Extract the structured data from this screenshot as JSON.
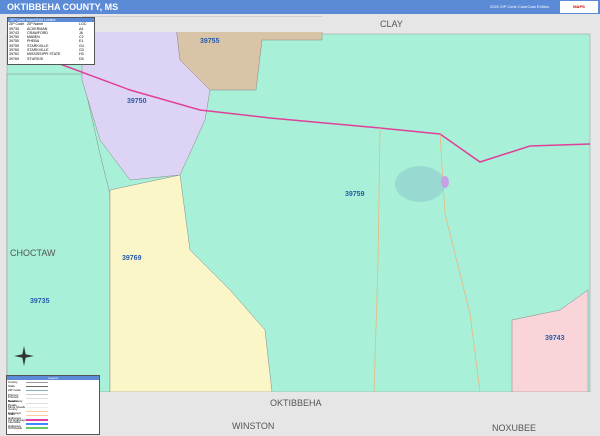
{
  "header": {
    "title": "OKTIBBEHA COUNTY, MS",
    "edition": "2020 ZIP Code ColorCast Edition",
    "logo": "MAPS"
  },
  "zip_table": {
    "title": "ZIP Code Index/Grid Locator",
    "columns": [
      "ZIP Code",
      "ZIP Name",
      "LOC"
    ],
    "rows": [
      [
        "39735",
        "ACKERMAN",
        "A4"
      ],
      [
        "39743",
        "CRAWFORD",
        "J6"
      ],
      [
        "39750",
        "MABEN",
        "C2"
      ],
      [
        "39755",
        "PHEBA",
        "E1"
      ],
      [
        "39759",
        "STARKVILLE",
        "G4"
      ],
      [
        "39760",
        "STARKVILLE",
        "G3"
      ],
      [
        "39762",
        "MISSISSIPPI STATE",
        "H3"
      ],
      [
        "39769",
        "STURGIS",
        "D5"
      ]
    ]
  },
  "zip_labels": {
    "z39755": "39755",
    "z39750": "39750",
    "z39759": "39759",
    "z39769": "39769",
    "z39735": "39735",
    "z39743": "39743"
  },
  "counties": {
    "clay": "CLAY",
    "choctaw": "CHOCTAW",
    "oktibbeha": "OKTIBBEHA",
    "winston": "WINSTON",
    "noxubee": "NOXUBEE"
  },
  "legend": {
    "title": "Legend",
    "items": [
      "County",
      "State",
      "ZIP Code",
      "Primary",
      "Primary Roads",
      "Secondary Roads",
      "Minor Roads",
      "County Highways",
      "State Highways",
      "US Highways",
      "Interstate Highways",
      "Toll Roads"
    ],
    "compass": "N"
  },
  "colors": {
    "header": "#5b8ad6",
    "teal": "#a8f0d8",
    "lavender": "#ddd4f5",
    "tan": "#d9c4a8",
    "yellow": "#fbf6c8",
    "pink": "#f9d4d8",
    "highway": "#e0409a"
  }
}
